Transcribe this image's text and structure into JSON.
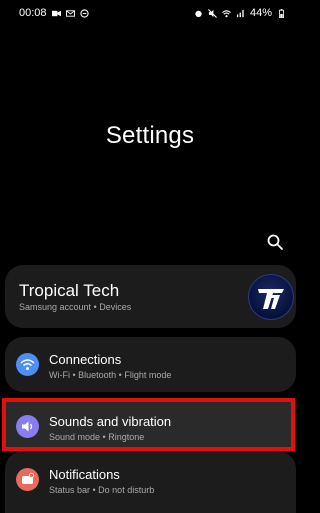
{
  "status_bar": {
    "time": "00:08",
    "battery": "44%"
  },
  "header": {
    "title": "Settings"
  },
  "account": {
    "name": "Tropical Tech",
    "subtitle": "Samsung account • Devices"
  },
  "items": [
    {
      "label": "Connections",
      "subtitle": "Wi-Fi • Bluetooth • Flight mode",
      "icon": "wifi-icon",
      "color": "#4f8ef5"
    },
    {
      "label": "Sounds and vibration",
      "subtitle": "Sound mode • Ringtone",
      "icon": "speaker-icon",
      "color": "#8a7df0"
    },
    {
      "label": "Notifications",
      "subtitle": "Status bar • Do not disturb",
      "icon": "notification-icon",
      "color": "#e86a5a"
    }
  ],
  "colors": {
    "background": "#000000",
    "card": "#1c1c1c",
    "highlight_border": "#e01010"
  }
}
